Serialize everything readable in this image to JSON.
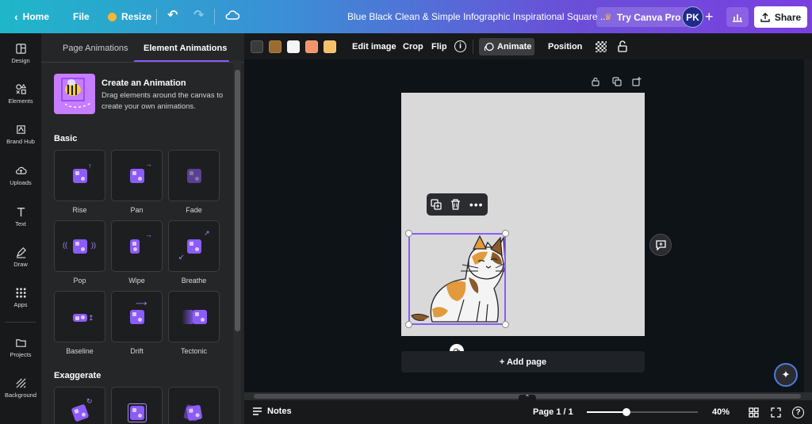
{
  "topbar": {
    "home": "Home",
    "file": "File",
    "resize": "Resize",
    "title": "Blue Black Clean & Simple Infographic Inspirational Square ...",
    "try_pro": "Try Canva Pro",
    "avatar": "PK",
    "share": "Share"
  },
  "rail": {
    "items": [
      {
        "label": "Design",
        "icon": "design-icon"
      },
      {
        "label": "Elements",
        "icon": "elements-icon"
      },
      {
        "label": "Brand Hub",
        "icon": "brand-hub-icon"
      },
      {
        "label": "Uploads",
        "icon": "uploads-icon"
      },
      {
        "label": "Text",
        "icon": "text-icon"
      },
      {
        "label": "Draw",
        "icon": "draw-icon"
      },
      {
        "label": "Apps",
        "icon": "apps-icon"
      },
      {
        "label": "Projects",
        "icon": "projects-icon"
      },
      {
        "label": "Background",
        "icon": "background-icon"
      }
    ]
  },
  "panel": {
    "tabs": [
      "Page Animations",
      "Element Animations"
    ],
    "active_tab": 1,
    "promo_title": "Create an Animation",
    "promo_desc": "Drag elements around the canvas to create your own animations.",
    "sections": [
      {
        "title": "Basic",
        "items": [
          "Rise",
          "Pan",
          "Fade",
          "Pop",
          "Wipe",
          "Breathe",
          "Baseline",
          "Drift",
          "Tectonic"
        ]
      },
      {
        "title": "Exaggerate",
        "items": [
          "",
          "",
          ""
        ]
      }
    ]
  },
  "toolbar": {
    "colors": [
      "#3a3a3a",
      "#9b6b30",
      "#f5f5f5",
      "#f2936b",
      "#f5c06a"
    ],
    "edit_image": "Edit image",
    "crop": "Crop",
    "flip": "Flip",
    "animate": "Animate",
    "position": "Position"
  },
  "canvas": {
    "add_page": "+ Add page",
    "page_color": "#d9d9d9",
    "selection_color": "#8b5cf6"
  },
  "bottombar": {
    "notes": "Notes",
    "page_indicator": "Page 1 / 1",
    "zoom": "40%",
    "zoom_level": 0.36
  }
}
